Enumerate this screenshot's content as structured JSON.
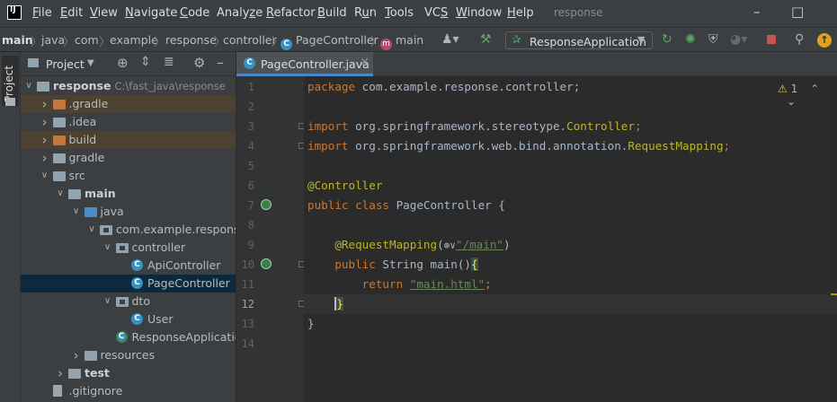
{
  "menubar": {
    "items": [
      "File",
      "Edit",
      "View",
      "Navigate",
      "Code",
      "Analyze",
      "Refactor",
      "Build",
      "Run",
      "Tools",
      "VCS",
      "Window",
      "Help"
    ],
    "mnemonics": [
      "F",
      "E",
      "V",
      "N",
      "C",
      "z",
      "R",
      "B",
      "u",
      "T",
      "S",
      "W",
      "H"
    ],
    "window_title": "response"
  },
  "navbar": {
    "crumbs": [
      "main",
      "java",
      "com",
      "example",
      "response",
      "controller",
      "PageController",
      "main"
    ],
    "run_config": "ResponseApplication"
  },
  "project_panel": {
    "side_tab": "Project",
    "title": "Project",
    "tree": [
      {
        "label": "response",
        "hint": "C:\\fast_java\\response",
        "bold": true,
        "icon": "folder-grey",
        "arrow": "down",
        "depth": 0
      },
      {
        "label": ".gradle",
        "icon": "folder-orange",
        "arrow": "right",
        "depth": 1,
        "excluded": true
      },
      {
        "label": ".idea",
        "icon": "folder-grey",
        "arrow": "right",
        "depth": 1
      },
      {
        "label": "build",
        "icon": "folder-orange",
        "arrow": "right",
        "depth": 1,
        "excluded": true
      },
      {
        "label": "gradle",
        "icon": "folder-grey",
        "arrow": "right",
        "depth": 1
      },
      {
        "label": "src",
        "icon": "folder-grey",
        "arrow": "down",
        "depth": 1
      },
      {
        "label": "main",
        "icon": "folder-grey",
        "arrow": "down",
        "depth": 2,
        "bold": true
      },
      {
        "label": "java",
        "icon": "folder-blue",
        "arrow": "down",
        "depth": 3
      },
      {
        "label": "com.example.response",
        "icon": "package",
        "arrow": "down",
        "depth": 4
      },
      {
        "label": "controller",
        "icon": "package",
        "arrow": "down",
        "depth": 5
      },
      {
        "label": "ApiController",
        "icon": "class",
        "arrow": "",
        "depth": 6
      },
      {
        "label": "PageController",
        "icon": "class",
        "arrow": "",
        "depth": 6,
        "selected": true
      },
      {
        "label": "dto",
        "icon": "package",
        "arrow": "down",
        "depth": 5
      },
      {
        "label": "User",
        "icon": "class",
        "arrow": "",
        "depth": 6
      },
      {
        "label": "ResponseApplication",
        "icon": "class-spring",
        "arrow": "",
        "depth": 5
      },
      {
        "label": "resources",
        "icon": "folder-grey",
        "arrow": "right",
        "depth": 3
      },
      {
        "label": "test",
        "icon": "folder-grey",
        "arrow": "right",
        "depth": 2,
        "bold": true
      },
      {
        "label": ".gitignore",
        "icon": "file",
        "arrow": "",
        "depth": 1
      }
    ]
  },
  "editor": {
    "tab_label": "PageController.java",
    "warning_count": "1",
    "line_numbers": [
      "1",
      "2",
      "3",
      "4",
      "5",
      "6",
      "7",
      "8",
      "9",
      "10",
      "11",
      "12",
      "13",
      "14"
    ],
    "current_line": "12",
    "code": {
      "l1_kw": "package",
      "l1_rest": " com.example.response.controller;",
      "l3_kw": "import",
      "l3_pkg": " org.springframework.stereotype.",
      "l3_cls": "Controller",
      "l3_end": ";",
      "l4_kw": "import",
      "l4_pkg": " org.springframework.web.bind.annotation.",
      "l4_cls": "RequestMapping",
      "l4_end": ";",
      "l6_ann": "@Controller",
      "l7_kw": "public class",
      "l7_rest": " PageController {",
      "l9_ann": "@RequestMapping",
      "l9_open": "(",
      "l9_icon": "⊛∨",
      "l9_str": "\"/main\"",
      "l9_close": ")",
      "l10_kw": "public",
      "l10_rest": " String main()",
      "l10_brace": "{",
      "l11_kw": "return",
      "l11_str": "\"main.html\"",
      "l11_end": ";",
      "l12_brace": "}",
      "l13": "}"
    }
  },
  "colors": {
    "keyword": "#cc7832",
    "annotation": "#bbb529",
    "string": "#6a8759",
    "text": "#a9b7c6",
    "panel": "#3c3f41",
    "editor": "#2b2b2b"
  }
}
